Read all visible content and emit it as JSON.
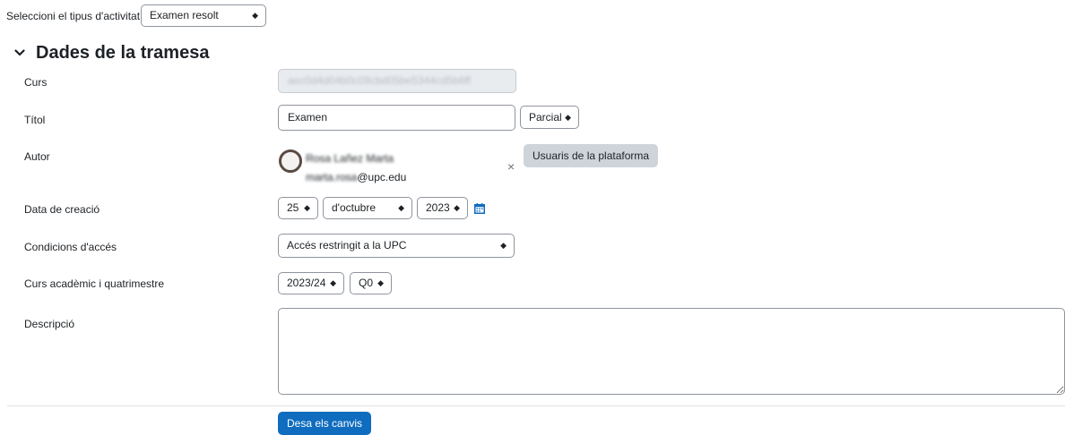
{
  "activity": {
    "label": "Seleccioni el tipus d'activitat",
    "selected": "Examen resolt"
  },
  "section": {
    "title": "Dades de la tramesa"
  },
  "fields": {
    "curs": {
      "label": "Curs",
      "value": "aec0d4d04b0c09cbd05be5344cd5b6ff"
    },
    "titol": {
      "label": "Títol",
      "value": "Examen",
      "type_selected": "Parcial"
    },
    "autor": {
      "label": "Autor",
      "name": "Rosa Lañez Marta",
      "email_user": "marta.rosa",
      "email_domain": "@upc.edu",
      "remove": "×",
      "button": "Usuaris de la plataforma"
    },
    "data": {
      "label": "Data de creació",
      "day": "25",
      "month": "d'octubre",
      "year": "2023"
    },
    "condicions": {
      "label": "Condicions d'accés",
      "selected": "Accés restringit a la UPC"
    },
    "curs_academic": {
      "label": "Curs acadèmic i quatrimestre",
      "year": "2023/24",
      "quarter": "Q0"
    },
    "descripcio": {
      "label": "Descripció",
      "value": ""
    }
  },
  "actions": {
    "save": "Desa els canvis"
  },
  "colors": {
    "primary": "#0f6cbf",
    "secondary": "#ced4da",
    "calendar_icon": "#0f6cbf"
  }
}
